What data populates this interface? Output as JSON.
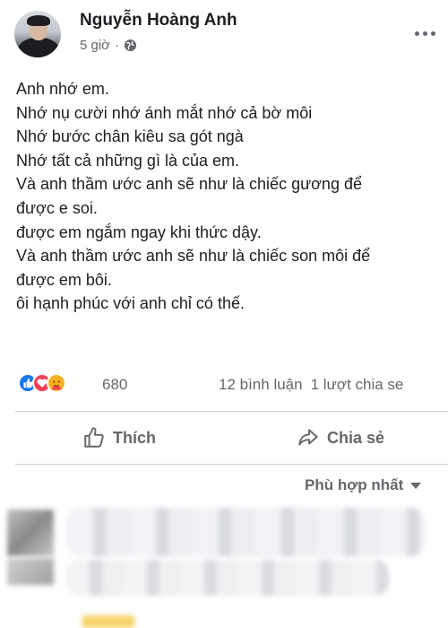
{
  "post": {
    "author": "Nguyễn Hoàng Anh",
    "time": "5 giờ",
    "separator": "·",
    "privacy_icon": "globe-icon",
    "more_icon": "ellipsis-icon",
    "lines": [
      "Anh nhớ em.",
      "Nhớ nụ cười nhớ ánh mắt nhớ cả bờ môi",
      "Nhớ bước chân kiêu sa gót ngà",
      "Nhớ tất cả những gì là của em.",
      "Và anh thầm ước anh sẽ như là chiếc gương để",
      "được e soi.",
      "được em ngắm ngay khi thức dậy.",
      "Và anh thầm ước anh sẽ như là chiếc son môi để",
      "được em bôi.",
      "ôi hạnh phúc với anh chỉ có thế."
    ]
  },
  "stats": {
    "reaction_icons": [
      "like-icon",
      "love-icon",
      "care-icon"
    ],
    "reaction_count": "680",
    "comments": "12 bình luận",
    "shares": "1 lượt chia se"
  },
  "actions": {
    "like_label": "Thích",
    "share_label": "Chia sẻ"
  },
  "comments": {
    "sort_label": "Phù hợp nhất"
  },
  "colors": {
    "text": "#1c1e21",
    "secondary": "#65676b",
    "like_blue": "#1877f2",
    "love_red": "#f33e58",
    "care_yellow": "#f7b125",
    "divider": "#ced0d4"
  }
}
